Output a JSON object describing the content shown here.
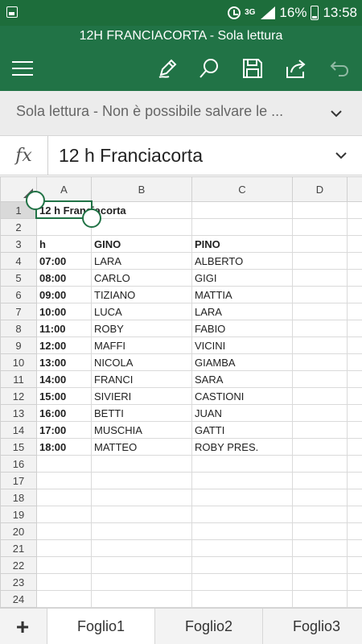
{
  "status_bar": {
    "network": "3G",
    "battery": "16%",
    "time": "13:58"
  },
  "title": "12H FRANCIACORTA - Sola lettura",
  "toolbar": {
    "icons": [
      "menu-icon",
      "pen-icon",
      "search-icon",
      "save-icon",
      "share-icon",
      "undo-icon"
    ]
  },
  "readonly_bar": {
    "text": "Sola lettura - Non è possibile salvare le ..."
  },
  "formula_bar": {
    "label": "fx",
    "value": "12 h Franciacorta"
  },
  "grid": {
    "columns": [
      "A",
      "B",
      "C",
      "D"
    ],
    "rows": [
      {
        "num": "1",
        "a": "12 h Franciacorta",
        "b": "",
        "c": ""
      },
      {
        "num": "2",
        "a": "",
        "b": "",
        "c": ""
      },
      {
        "num": "3",
        "a": "h",
        "b": "GINO",
        "c": "PINO"
      },
      {
        "num": "4",
        "a": "07:00",
        "b": "LARA",
        "c": "ALBERTO"
      },
      {
        "num": "5",
        "a": "08:00",
        "b": "CARLO",
        "c": "GIGI"
      },
      {
        "num": "6",
        "a": "09:00",
        "b": "TIZIANO",
        "c": "MATTIA"
      },
      {
        "num": "7",
        "a": "10:00",
        "b": "LUCA",
        "c": "LARA"
      },
      {
        "num": "8",
        "a": "11:00",
        "b": "ROBY",
        "c": "FABIO"
      },
      {
        "num": "9",
        "a": "12:00",
        "b": "MAFFI",
        "c": "VICINI"
      },
      {
        "num": "10",
        "a": "13:00",
        "b": "NICOLA",
        "c": "GIAMBA"
      },
      {
        "num": "11",
        "a": "14:00",
        "b": "FRANCI",
        "c": "SARA"
      },
      {
        "num": "12",
        "a": "15:00",
        "b": "SIVIERI",
        "c": "CASTIONI"
      },
      {
        "num": "13",
        "a": "16:00",
        "b": "BETTI",
        "c": "JUAN"
      },
      {
        "num": "14",
        "a": "17:00",
        "b": "MUSCHIA",
        "c": "GATTI"
      },
      {
        "num": "15",
        "a": "18:00",
        "b": "MATTEO",
        "c": "ROBY PRES."
      },
      {
        "num": "16",
        "a": "",
        "b": "",
        "c": ""
      },
      {
        "num": "17",
        "a": "",
        "b": "",
        "c": ""
      },
      {
        "num": "18",
        "a": "",
        "b": "",
        "c": ""
      },
      {
        "num": "19",
        "a": "",
        "b": "",
        "c": ""
      },
      {
        "num": "20",
        "a": "",
        "b": "",
        "c": ""
      },
      {
        "num": "21",
        "a": "",
        "b": "",
        "c": ""
      },
      {
        "num": "22",
        "a": "",
        "b": "",
        "c": ""
      },
      {
        "num": "23",
        "a": "",
        "b": "",
        "c": ""
      },
      {
        "num": "24",
        "a": "",
        "b": "",
        "c": ""
      }
    ],
    "selected_cell": "A1"
  },
  "sheet_tabs": {
    "add_label": "+",
    "tabs": [
      "Foglio1",
      "Foglio2",
      "Foglio3"
    ],
    "active": "Foglio1"
  },
  "colors": {
    "brand": "#217346",
    "status_bar": "#1d6d3b"
  }
}
